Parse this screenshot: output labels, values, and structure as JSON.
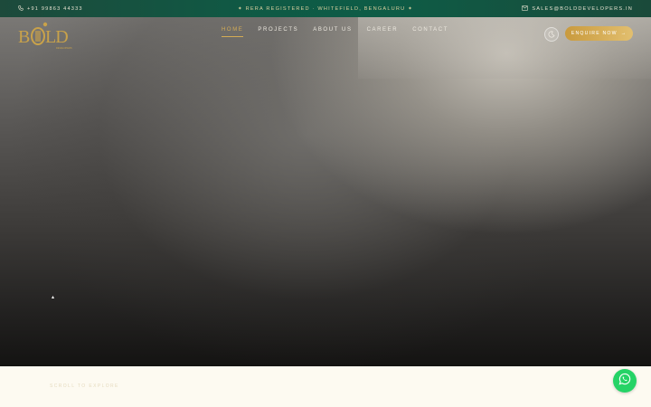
{
  "topbar": {
    "phone": "+91 99863 44333",
    "center_text": "✦ RERA REGISTERED · WHITEFIELD, BENGALURU ✦",
    "email": "SALES@BOLDDEVELOPERS.IN"
  },
  "brand": {
    "logo_text": "BOLD",
    "logo_small": "DEVELOPERS",
    "accent_color": "#d4ac55",
    "topbar_color": "#0e5c46"
  },
  "nav": {
    "items": [
      {
        "label": "HOME",
        "active": true
      },
      {
        "label": "PROJECTS",
        "active": false
      },
      {
        "label": "ABOUT US",
        "active": false
      },
      {
        "label": "CAREER",
        "active": false
      },
      {
        "label": "CONTACT",
        "active": false
      }
    ]
  },
  "header": {
    "enquire_label": "ENQUIRE NOW",
    "enquire_arrow": "→",
    "theme_icon": "moon-icon"
  },
  "hero": {
    "caret": "▴"
  },
  "bottom": {
    "scroll_label": "SCROLL TO EXPLORE"
  },
  "icons": {
    "phone": "phone-icon",
    "mail": "mail-icon",
    "whatsapp": "whatsapp-icon"
  }
}
